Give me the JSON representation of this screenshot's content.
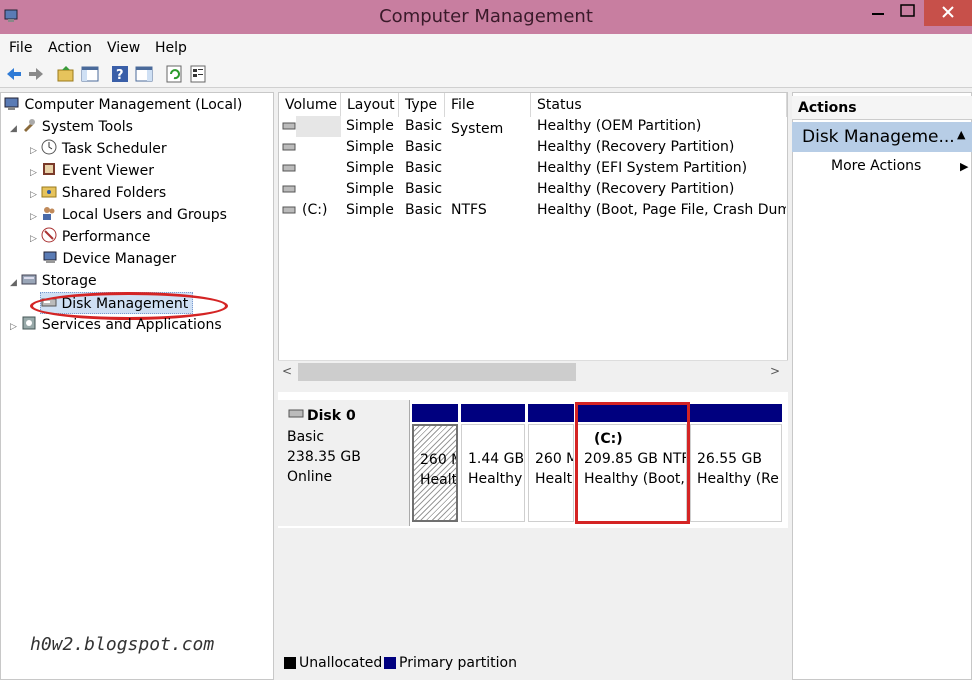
{
  "window": {
    "title": "Computer Management"
  },
  "menu": [
    "File",
    "Action",
    "View",
    "Help"
  ],
  "tree": {
    "root": "Computer Management (Local)",
    "system_tools": "System Tools",
    "items": [
      "Task Scheduler",
      "Event Viewer",
      "Shared Folders",
      "Local Users and Groups",
      "Performance",
      "Device Manager"
    ],
    "storage": "Storage",
    "disk_management": "Disk Management",
    "services": "Services and Applications"
  },
  "volume_table": {
    "columns": [
      "Volume",
      "Layout",
      "Type",
      "File System",
      "Status"
    ],
    "rows": [
      {
        "volume": "",
        "layout": "Simple",
        "type": "Basic",
        "fs": "",
        "status": "Healthy (OEM Partition)"
      },
      {
        "volume": "",
        "layout": "Simple",
        "type": "Basic",
        "fs": "",
        "status": "Healthy (Recovery Partition)"
      },
      {
        "volume": "",
        "layout": "Simple",
        "type": "Basic",
        "fs": "",
        "status": "Healthy (EFI System Partition)"
      },
      {
        "volume": "",
        "layout": "Simple",
        "type": "Basic",
        "fs": "",
        "status": "Healthy (Recovery Partition)"
      },
      {
        "volume": "(C:)",
        "layout": "Simple",
        "type": "Basic",
        "fs": "NTFS",
        "status": "Healthy (Boot, Page File, Crash Dump,"
      }
    ]
  },
  "disk": {
    "name": "Disk 0",
    "type": "Basic",
    "size": "238.35 GB",
    "status": "Online",
    "partitions": [
      {
        "label": "",
        "size": "260 M",
        "status": "Healt"
      },
      {
        "label": "",
        "size": "1.44 GB",
        "status": "Healthy"
      },
      {
        "label": "",
        "size": "260 M",
        "status": "Healt"
      },
      {
        "label": "(C:)",
        "size": "209.85 GB NTF",
        "status": "Healthy (Boot,"
      },
      {
        "label": "",
        "size": "26.55 GB",
        "status": "Healthy (Re"
      }
    ]
  },
  "legend": {
    "unallocated": "Unallocated",
    "primary": "Primary partition"
  },
  "actions": {
    "header": "Actions",
    "section": "Disk Manageme...",
    "more": "More Actions"
  },
  "watermark": "h0w2.blogspot.com",
  "colors": {
    "titlebar": "#c87ea0",
    "partition_header": "#00007f",
    "highlight": "#d42424",
    "actions_section": "#b7cde6"
  }
}
